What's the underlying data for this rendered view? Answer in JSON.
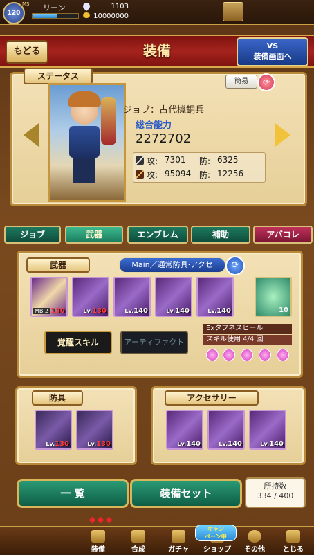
{
  "topbar": {
    "level": "120",
    "ms_label": "MS",
    "username": "リーン",
    "exp_progress": 0.55,
    "stones": "1103",
    "gold": "10000000"
  },
  "header": {
    "back_label": "もどる",
    "title": "装備",
    "vs_label_line1": "VS",
    "vs_label_line2": "装備画面へ"
  },
  "status": {
    "tab_label": "ステータス",
    "simple_label": "簡易",
    "job_label": "ジョブ：古代機銅兵",
    "power_label": "総合能力",
    "power_value": "2272702",
    "row1_atk_label": "攻:",
    "row1_atk": "7301",
    "row1_def_label": "防:",
    "row1_def": "6325",
    "row2_atk_label": "攻:",
    "row2_atk": "95094",
    "row2_def_label": "防:",
    "row2_def": "12256"
  },
  "tabs": [
    {
      "label": "ジョブ"
    },
    {
      "label": "武器"
    },
    {
      "label": "エンブレム"
    },
    {
      "label": "補助"
    },
    {
      "label": "アバコレ"
    }
  ],
  "weapon": {
    "tab_label": "武器",
    "main_tag": "Main／通常防具·アクセ",
    "cards": [
      {
        "lv_prefix": "MB.2",
        "lv": "130"
      },
      {
        "lv_prefix": "Lv.",
        "lv": "130"
      },
      {
        "lv_prefix": "Lv.",
        "lv": "140"
      },
      {
        "lv_prefix": "Lv.",
        "lv": "140"
      },
      {
        "lv_prefix": "Lv.",
        "lv": "140"
      }
    ],
    "potion_count": "10",
    "awaken_label": "覚醒スキル",
    "artifact_label": "アーティファクト",
    "skill_name": "Exタフネスヒール",
    "skill_uses": "スキル使用 4/4 回"
  },
  "armor": {
    "tab_label": "防具",
    "cards": [
      {
        "lv_prefix": "Lv.",
        "lv": "130"
      },
      {
        "lv_prefix": "Lv.",
        "lv": "130"
      }
    ]
  },
  "accessory": {
    "tab_label": "アクセサリー",
    "cards": [
      {
        "lv_prefix": "Lv.",
        "lv": "140"
      },
      {
        "lv_prefix": "Lv.",
        "lv": "140"
      },
      {
        "lv_prefix": "Lv.",
        "lv": "140"
      }
    ]
  },
  "bottom": {
    "list_label": "一 覧",
    "set_label": "装備セット",
    "owned_label": "所持数",
    "owned_value": "334 / 400"
  },
  "nav": [
    {
      "label": "装備",
      "icon": "equip-icon"
    },
    {
      "label": "合成",
      "icon": "synthesis-icon"
    },
    {
      "label": "ガチャ",
      "icon": "gacha-icon"
    },
    {
      "label": "ショップ",
      "icon": "shop-icon"
    },
    {
      "label": "その他",
      "icon": "gear-icon"
    },
    {
      "label": "とじる",
      "icon": "close-icon"
    }
  ],
  "campaign_label_line1": "キャン",
  "campaign_label_line2": "ペーン中",
  "colors": {
    "accent_green": "#1c7d5e",
    "header_red": "#a5231d",
    "vs_blue": "#2a4fa8",
    "gold": "#d8b65a"
  }
}
